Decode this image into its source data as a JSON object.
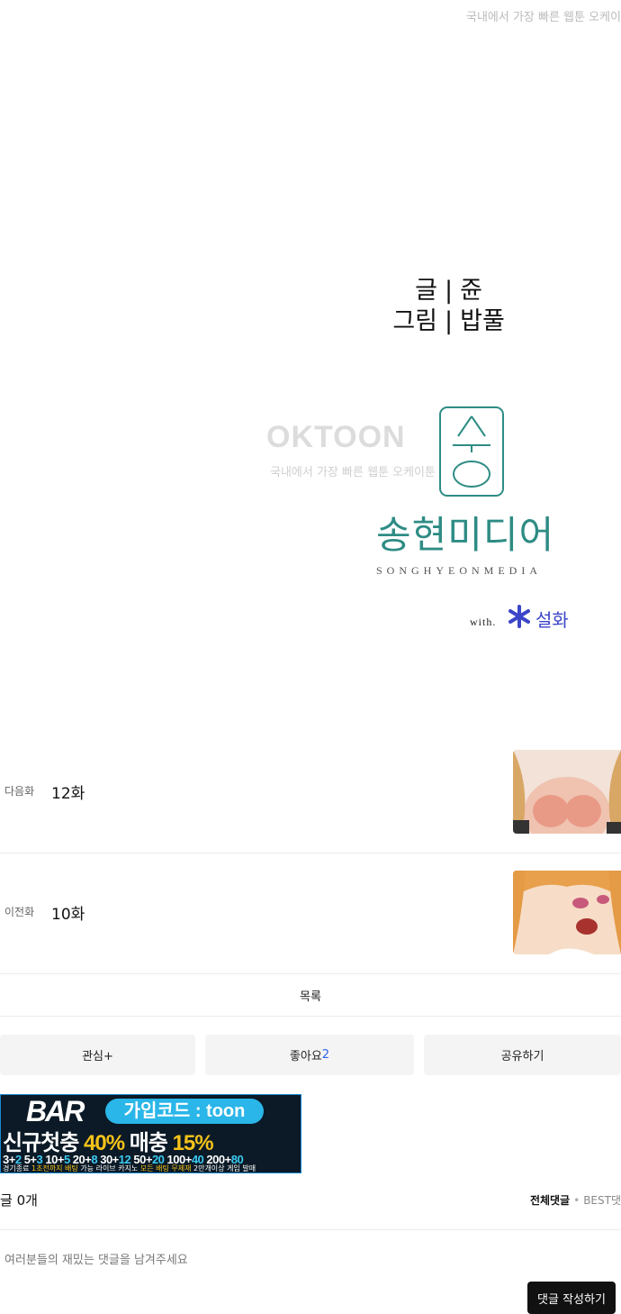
{
  "watermark": {
    "top_text": "국내에서 가장 빠른 웹툰 오케이",
    "brand": "OKTOON",
    "brand_sub": "국내에서 가장 빠른 웹툰 오케이툰"
  },
  "credits": {
    "writer_label": "글",
    "writer": "쥰",
    "artist_label": "그림",
    "artist": "밥풀",
    "separator": "|"
  },
  "publisher": {
    "name_ko": "송현미디어",
    "name_en": "SONGHYEONMEDIA",
    "with": "with.",
    "partner": "설화",
    "partner_color": "#3b45c8",
    "brand_color": "#2e8c84"
  },
  "episodes": {
    "next": {
      "label": "다음화",
      "title": "12화"
    },
    "prev": {
      "label": "이전화",
      "title": "10화"
    }
  },
  "nav": {
    "list_label": "목록"
  },
  "actions": {
    "interest_label": "관심+",
    "like_label": "좋아요",
    "like_count": "2",
    "share_label": "공유하기"
  },
  "banner": {
    "logo": "BAR",
    "code": "가입코드 : toon",
    "promo_prefix": "신규첫충",
    "promo_first": "40%",
    "promo_mid": "매충",
    "promo_second": "15%",
    "bonus_1a": "3+",
    "bonus_1b": "2",
    "bonus_2a": "5+",
    "bonus_2b": "3",
    "bonus_3a": "10+",
    "bonus_3b": "5",
    "bonus_4a": "20+",
    "bonus_4b": "8",
    "bonus_5a": "30+",
    "bonus_5b": "12",
    "bonus_6a": "50+",
    "bonus_6b": "20",
    "bonus_7a": "100+",
    "bonus_7b": "40",
    "bonus_8a": "200+",
    "bonus_8b": "80",
    "fine_a": "경기종료 ",
    "fine_b": "1초전까지 배팅",
    "fine_c": " 가능 라이브 카지노 ",
    "fine_d": "모든 배팅 무제재",
    "fine_e": " 2만개이상 게임 발매"
  },
  "comments": {
    "count_label": "글 0개",
    "tab_all": "전체댓글",
    "tab_dot": "•",
    "tab_best": "BEST댓",
    "placeholder": "여러분들의 재밌는 댓글을 남겨주세요",
    "submit_label": "댓글 작성하기"
  }
}
